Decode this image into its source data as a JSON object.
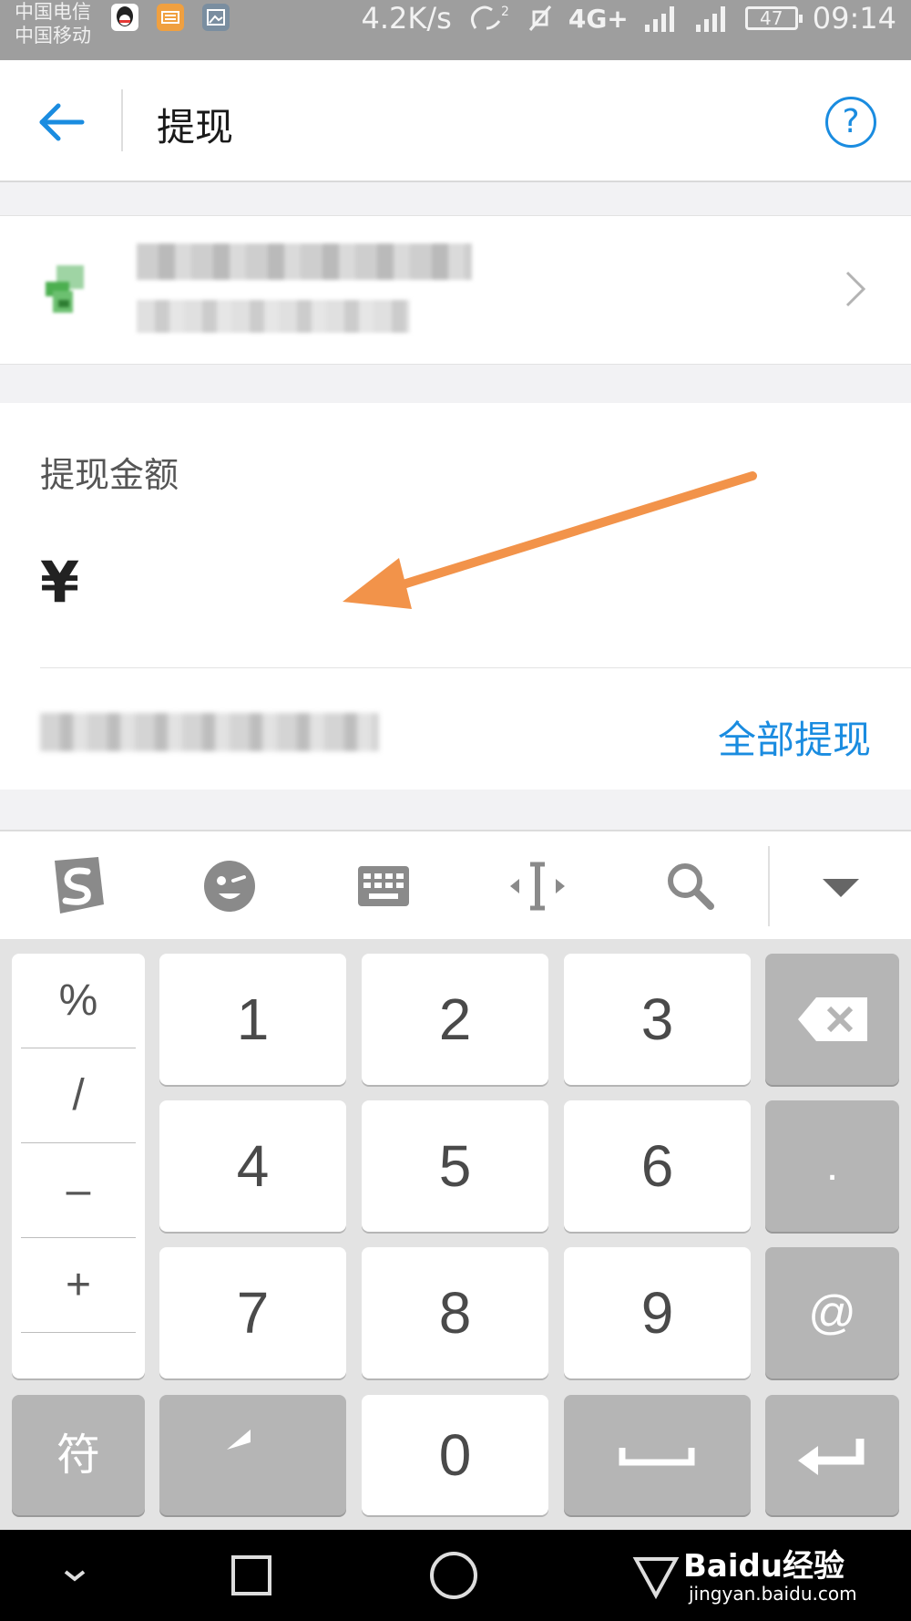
{
  "status_bar": {
    "carrier_1": "中国电信",
    "carrier_2": "中国移动",
    "net_speed": "4.2K/s",
    "network_label": "4G+",
    "battery": "47",
    "time": "09:14"
  },
  "header": {
    "title": "提现",
    "help_symbol": "?"
  },
  "amount": {
    "label": "提现金额",
    "currency_symbol": "¥",
    "value": "",
    "withdraw_all_label": "全部提现"
  },
  "keyboard": {
    "symbols": [
      "%",
      "/",
      "–",
      "+"
    ],
    "digit_rows": [
      [
        "1",
        "2",
        "3"
      ],
      [
        "4",
        "5",
        "6"
      ],
      [
        "7",
        "8",
        "9"
      ]
    ],
    "dot_key": ".",
    "at_key": "@",
    "symbol_key": "符",
    "zero_key": "0"
  },
  "watermark": {
    "brand": "Baidu经验",
    "domain": "jingyan.baidu.com"
  },
  "colors": {
    "accent": "#1a8ce0",
    "annotation_arrow": "#f2934a",
    "key_gray": "#b5b5b5"
  }
}
